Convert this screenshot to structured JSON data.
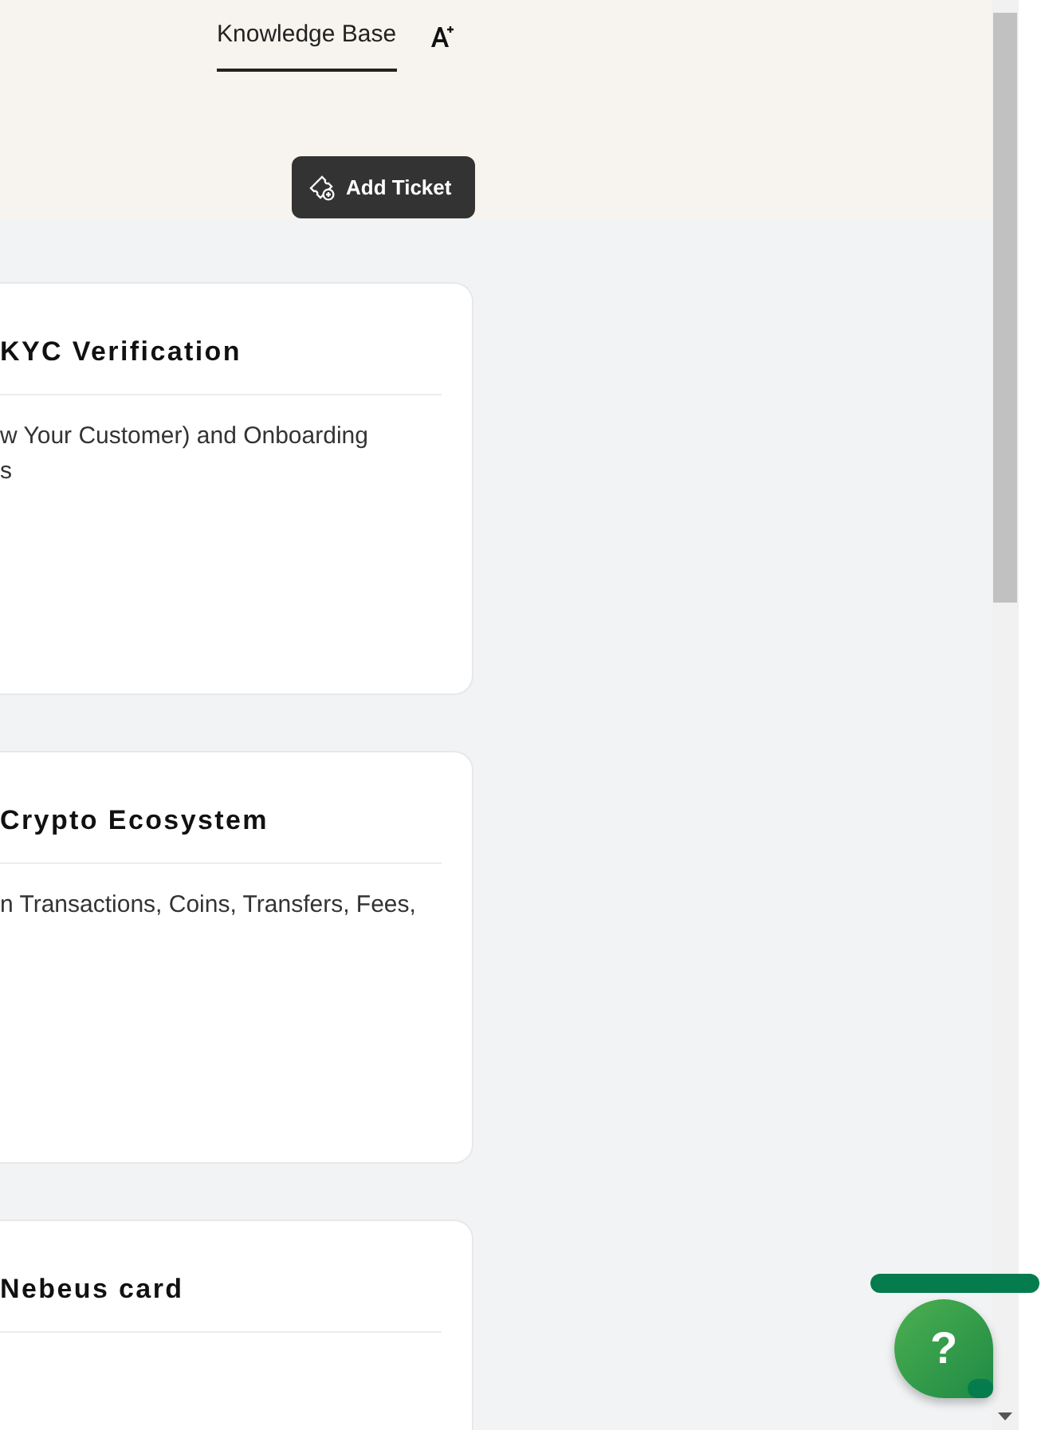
{
  "header": {
    "tabs": [
      {
        "label": "Knowledge Base",
        "selected": true
      }
    ],
    "add_ticket_button": "Add Ticket"
  },
  "cards": [
    {
      "title": "KYC Verification",
      "description": [
        "w Your Customer) and Onboarding",
        "s"
      ]
    },
    {
      "title": "Crypto Ecosystem",
      "description": [
        "n Transactions, Coins, Transfers, Fees,"
      ]
    },
    {
      "title": "Nebeus card"
    }
  ],
  "help_button": {
    "label": "?"
  }
}
